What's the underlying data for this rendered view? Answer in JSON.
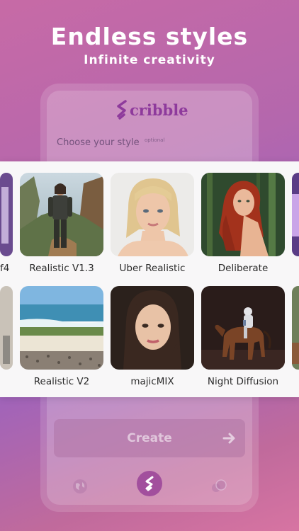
{
  "hero": {
    "title": "Endless styles",
    "subtitle": "Infinite creativity"
  },
  "app": {
    "logo_text": "cribble",
    "choose_label": "Choose your style",
    "optional_label": "optional"
  },
  "styles": {
    "row1": [
      {
        "name": "Realistic V1.3",
        "icon": "soldier-woman-canyon"
      },
      {
        "name": "Uber Realistic",
        "icon": "blonde-woman-portrait"
      },
      {
        "name": "Deliberate",
        "icon": "redhead-woman-forest"
      }
    ],
    "row2": [
      {
        "name": "Realistic V2",
        "icon": "beach-landscape"
      },
      {
        "name": "majicMIX",
        "icon": "brunette-woman-portrait"
      },
      {
        "name": "Night Diffusion",
        "icon": "astronaut-on-horse"
      }
    ],
    "partial_left_label": "f4"
  },
  "create_button": {
    "label": "Create"
  },
  "nav": {
    "left_icon": "globe-icon",
    "center_icon": "scribble-logo-icon",
    "right_icon": "group-icon"
  },
  "colors": {
    "accent": "#a24f9d",
    "logo": "#8e3a9c"
  }
}
